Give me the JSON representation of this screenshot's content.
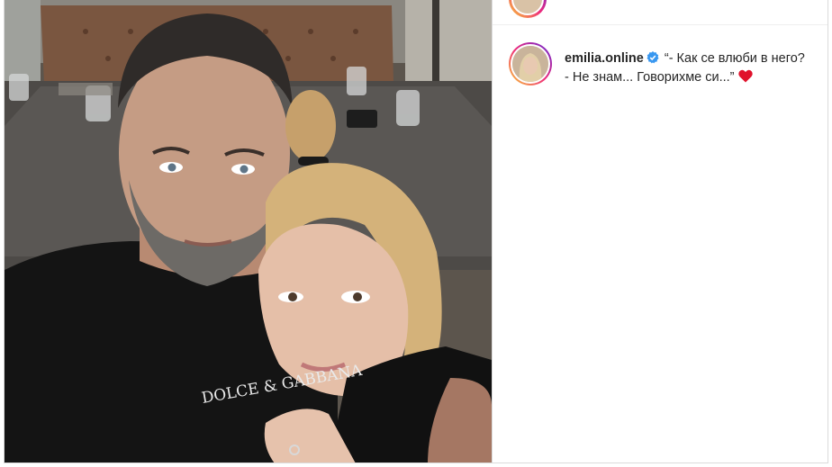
{
  "post": {
    "username": "emilia.online",
    "caption_line1": "“- Как се влюби в него?",
    "caption_line2": "- Не знам... Говорихме си...”",
    "photo_print": "DOLCE & GABBANA"
  },
  "icons": {
    "verified": "verified-badge-icon",
    "heart": "red-heart-emoji-icon"
  },
  "colors": {
    "verified_blue": "#3897f0",
    "heart_red": "#e0112b",
    "ring_start": "#f9ce34",
    "ring_mid": "#ee2a7b",
    "ring_end": "#6228d7"
  }
}
